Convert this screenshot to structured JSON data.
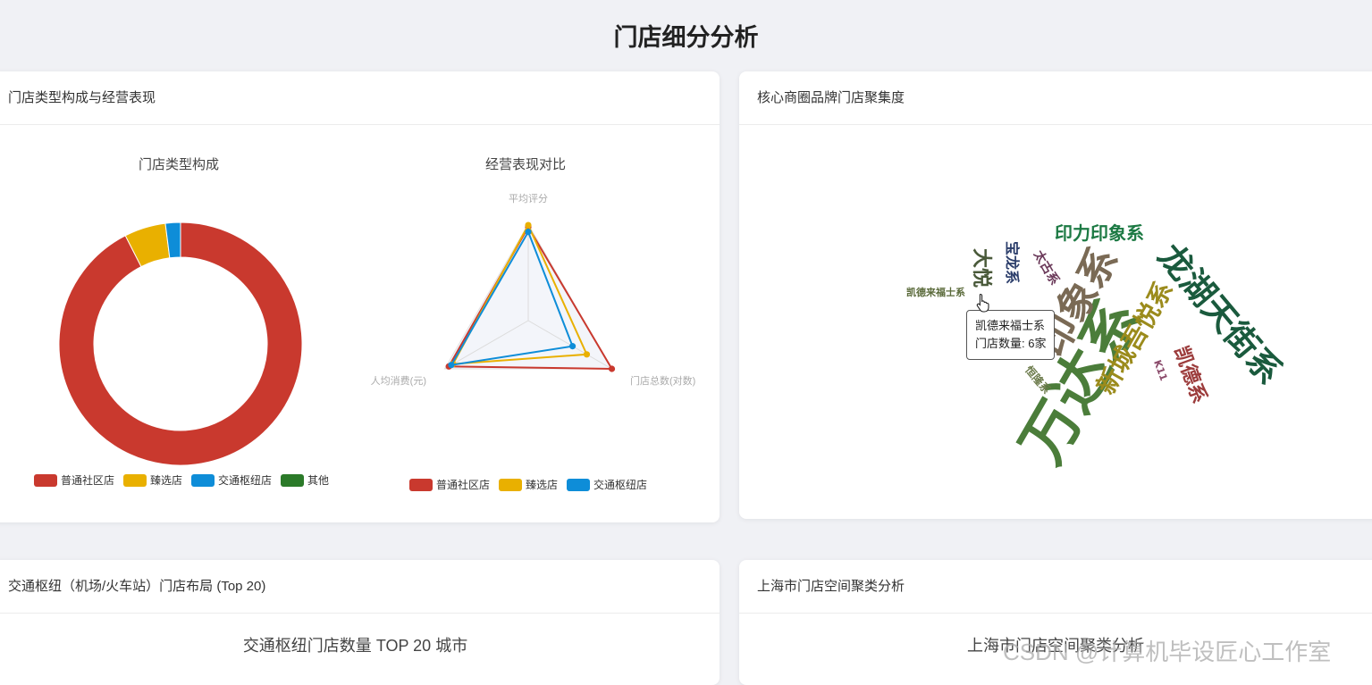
{
  "page": {
    "title": "门店细分分析"
  },
  "cards": {
    "type_performance": {
      "title": "门店类型构成与经营表现"
    },
    "brand_density": {
      "title": "核心商圈品牌门店聚集度"
    },
    "transit_hub": {
      "title": "交通枢纽（机场/火车站）门店布局 (Top 20)"
    },
    "shanghai_cluster": {
      "title": "上海市门店空间聚类分析"
    }
  },
  "chart_data": [
    {
      "type": "pie",
      "variant": "donut",
      "title": "门店类型构成",
      "categories": [
        "普通社区店",
        "臻选店",
        "交通枢纽店",
        "其他"
      ],
      "values": [
        92.5,
        5.5,
        2.0,
        0.0
      ],
      "colors": [
        "#c9392e",
        "#e9b000",
        "#0e8dd8",
        "#2b7a29"
      ],
      "legend_position": "bottom"
    },
    {
      "type": "radar",
      "title": "经营表现对比",
      "indicators": [
        "平均评分",
        "门店总数(对数)",
        "人均消费(元)"
      ],
      "series": [
        {
          "name": "普通社区店",
          "values": [
            0.97,
            1.0,
            0.95
          ]
        },
        {
          "name": "臻选店",
          "values": [
            0.99,
            0.7,
            0.9
          ]
        },
        {
          "name": "交通枢纽店",
          "values": [
            0.92,
            0.53,
            0.92
          ]
        }
      ],
      "colors": [
        "#c9392e",
        "#e9b000",
        "#0e8dd8"
      ],
      "legend_position": "bottom"
    },
    {
      "type": "wordcloud",
      "words": [
        {
          "text": "万达系",
          "color": "#4b7d3a"
        },
        {
          "text": "龙湖天街系",
          "color": "#1a5a3d"
        },
        {
          "text": "印象系",
          "color": "#7a6a55"
        },
        {
          "text": "新城吾悦系",
          "color": "#9b8b1c"
        },
        {
          "text": "印力印象系",
          "color": "#1d7a44"
        },
        {
          "text": "凯德系",
          "color": "#9c3c3c"
        },
        {
          "text": "大悦",
          "color": "#4a5a3a"
        },
        {
          "text": "宝龙系",
          "color": "#2c3e6b"
        },
        {
          "text": "太古系",
          "color": "#6b3a5a"
        },
        {
          "text": "恒隆系",
          "color": "#6b7a4a"
        },
        {
          "text": "K11",
          "color": "#8a4a6a"
        },
        {
          "text": "凯德来福士系",
          "color": "#5a6a3a"
        }
      ]
    },
    {
      "type": "bar",
      "title": "交通枢纽门店数量 TOP 20 城市"
    },
    {
      "type": "scatter",
      "title": "上海市门店空间聚类分析"
    }
  ],
  "tooltip": {
    "line1": "凯德来福士系",
    "line2": "门店数量: 6家"
  },
  "watermark": "CSDN @计算机毕设匠心工作室"
}
